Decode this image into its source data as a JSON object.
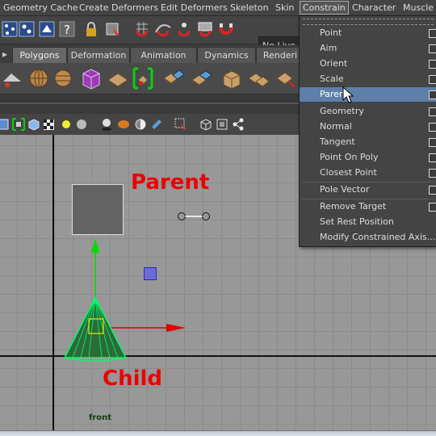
{
  "menubar": {
    "items": [
      "Geometry Cache",
      "Create Deformers",
      "Edit Deformers",
      "Skeleton",
      "Skin",
      "Constrain",
      "Character",
      "Muscle"
    ],
    "active": "Constrain"
  },
  "status_line": {
    "live_surface": "No Live Su"
  },
  "shelf": {
    "tabs": [
      "Polygons",
      "Deformation",
      "Animation",
      "Dynamics",
      "Renderi"
    ],
    "active_tab": "Polygons"
  },
  "viewport": {
    "parent_label": "Parent",
    "child_label": "Child",
    "view_name": "front",
    "colors": {
      "axis_y": "#00dd00",
      "axis_x": "#dd0000",
      "cone_wire": "#00ff66",
      "annotation": "#ee0000",
      "background": "#989898"
    }
  },
  "constrain_menu": {
    "items": [
      {
        "label": "Point",
        "option_box": true
      },
      {
        "label": "Aim",
        "option_box": true
      },
      {
        "label": "Orient",
        "option_box": true
      },
      {
        "label": "Scale",
        "option_box": true
      },
      {
        "label": "Parent",
        "option_box": true,
        "highlighted": true
      },
      {
        "label": "Geometry",
        "option_box": true
      },
      {
        "label": "Normal",
        "option_box": true
      },
      {
        "label": "Tangent",
        "option_box": true
      },
      {
        "label": "Point On Poly",
        "option_box": true
      },
      {
        "label": "Closest Point",
        "option_box": true
      },
      {
        "label": "Pole Vector",
        "option_box": true
      },
      {
        "label": "Remove Target",
        "option_box": true
      },
      {
        "label": "Set Rest Position",
        "option_box": false
      },
      {
        "label": "Modify Constrained Axis...",
        "option_box": false
      }
    ],
    "highlight_color": "#5d7fa9"
  }
}
